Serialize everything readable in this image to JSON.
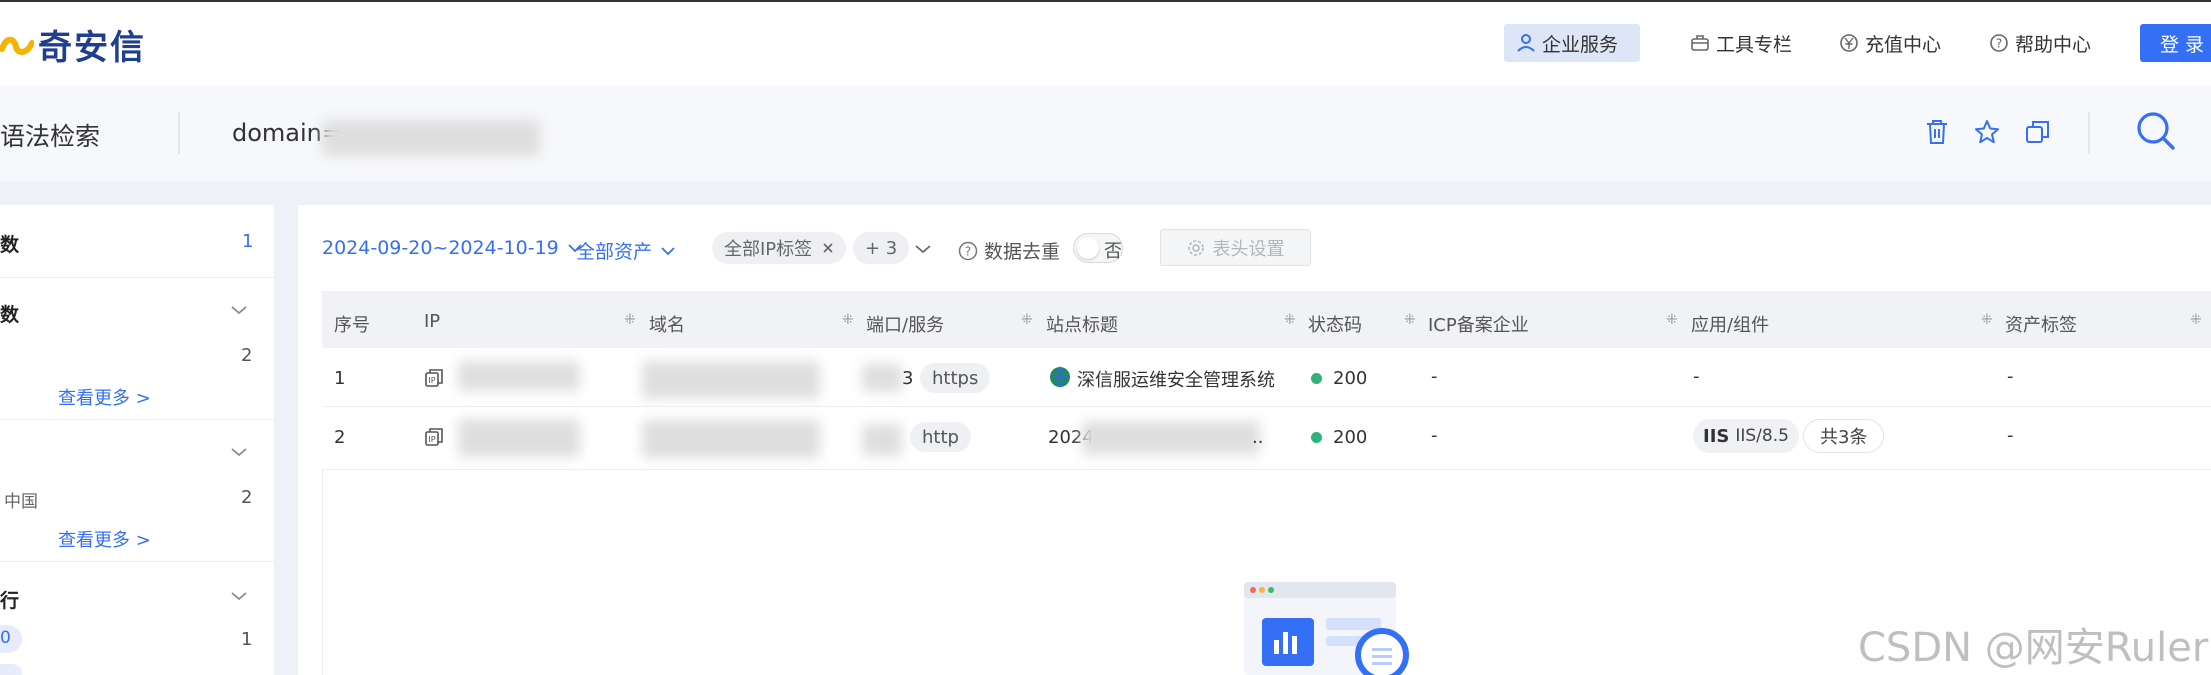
{
  "colors": {
    "brand": "#3470f5",
    "logo": "#1f3e8f",
    "status_ok": "#2fb37b"
  },
  "logo": {
    "text": "奇安信",
    "icon": "qianxin-logo-icon"
  },
  "nav": {
    "items": [
      {
        "label": "企业服务",
        "icon": "enterprise-icon",
        "active": true
      },
      {
        "label": "工具专栏",
        "icon": "toolbox-icon"
      },
      {
        "label": "充值中心",
        "icon": "yen-icon"
      },
      {
        "label": "帮助中心",
        "icon": "help-icon"
      }
    ],
    "login": "登 录"
  },
  "search": {
    "mode_label": "语法检索",
    "query_prefix": "domain=",
    "actions": [
      "trash-icon",
      "star-icon",
      "copy-icon",
      "search-icon"
    ]
  },
  "sidebar": {
    "sections": [
      {
        "title": "数",
        "count": "1"
      },
      {
        "title": "数",
        "items": [
          {
            "label": "",
            "count": "2"
          }
        ],
        "more": "查看更多 >"
      },
      {
        "title": "",
        "items": [
          {
            "label": "中国",
            "count": "2"
          }
        ],
        "more": "查看更多 >"
      },
      {
        "title": "行",
        "items": [
          {
            "label": "0",
            "count": "1"
          }
        ]
      }
    ]
  },
  "filters": {
    "date_range": "2024-09-20~2024-10-19",
    "asset_scope": "全部资产",
    "ip_tag_chip": "全部IP标签",
    "more_chip": "+ 3",
    "dedupe_label": "数据去重",
    "dedupe_value": "否",
    "header_settings": "表头设置"
  },
  "table": {
    "columns": [
      "序号",
      "IP",
      "域名",
      "端口/服务",
      "站点标题",
      "状态码",
      "ICP备案企业",
      "应用/组件",
      "资产标签"
    ],
    "rows": [
      {
        "index": "1",
        "ip": "",
        "domain": "",
        "port_suffix": "3",
        "service": "https",
        "title": "深信服运维安全管理系统",
        "status": "200",
        "icp": "-",
        "component": "-",
        "tags": "-"
      },
      {
        "index": "2",
        "ip": "",
        "domain": "",
        "port_suffix": "",
        "service": "http",
        "title_prefix": "2024",
        "title_suffix": "..",
        "status": "200",
        "icp": "-",
        "component_logo": "IIS",
        "component": "IIS/8.5",
        "component_more": "共3条",
        "tags": "-"
      }
    ]
  },
  "watermark": "CSDN @网安Ruler"
}
